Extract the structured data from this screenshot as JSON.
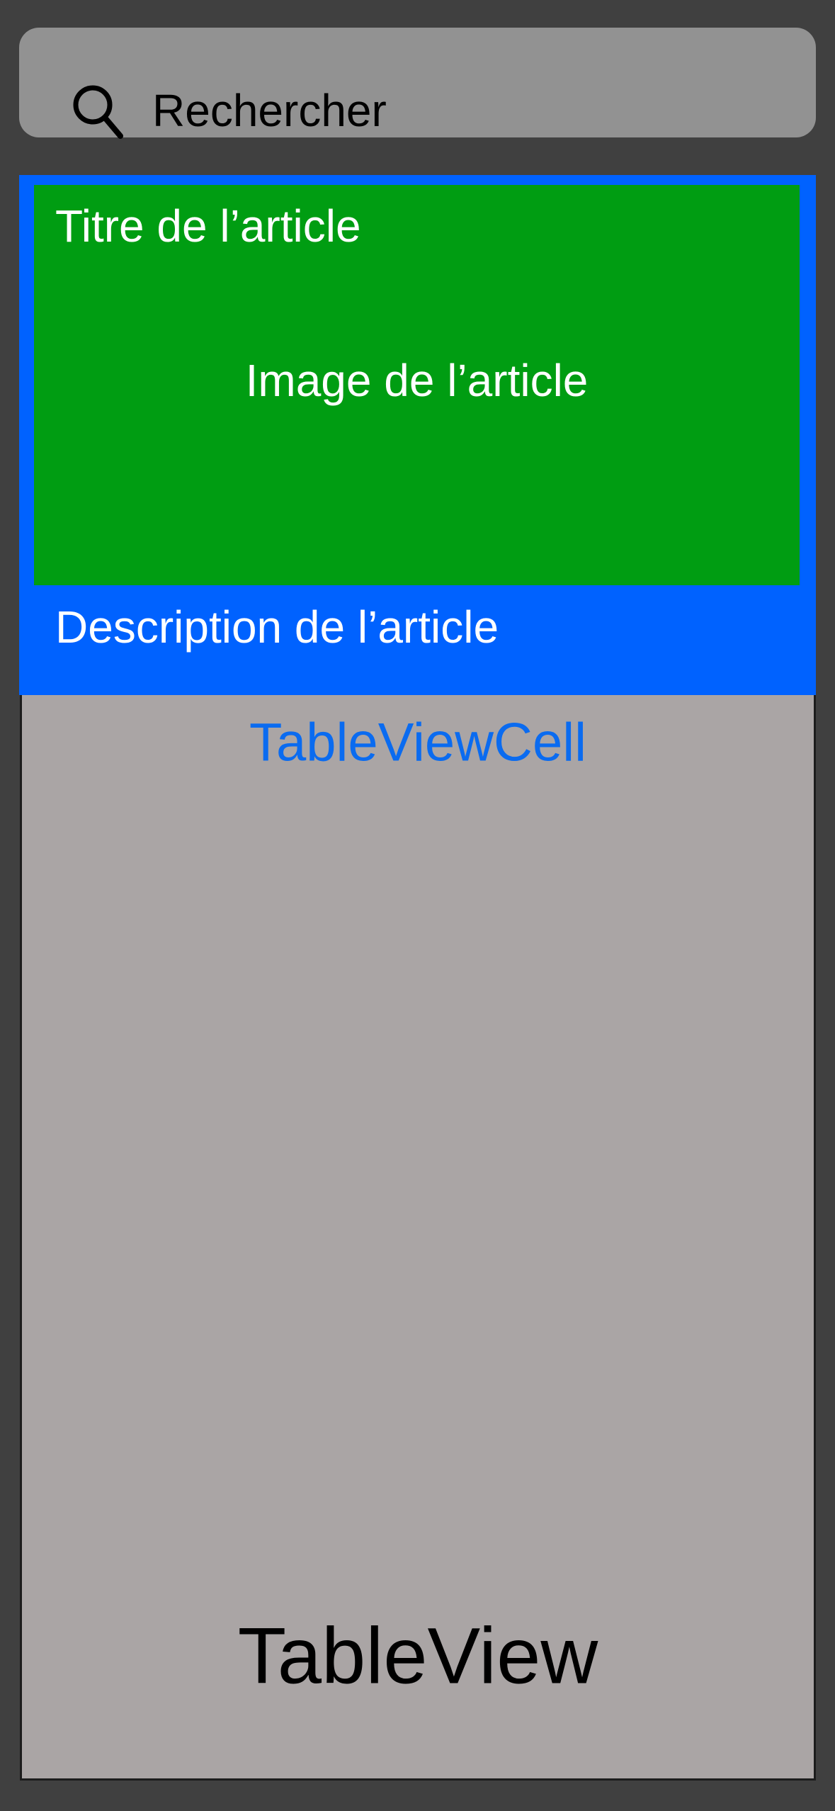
{
  "search": {
    "placeholder": "Rechercher",
    "icon": "search-icon"
  },
  "cell": {
    "title": "Titre de l’article",
    "image_label": "Image de l’article",
    "description": "Description de l’article",
    "caption": "TableViewCell"
  },
  "table": {
    "label": "TableView"
  },
  "colors": {
    "background": "#404040",
    "search_bar": "#929292",
    "cell": "#0062ff",
    "image": "#009d12",
    "table": "#aaa5a5",
    "caption": "#0a6bf0"
  }
}
